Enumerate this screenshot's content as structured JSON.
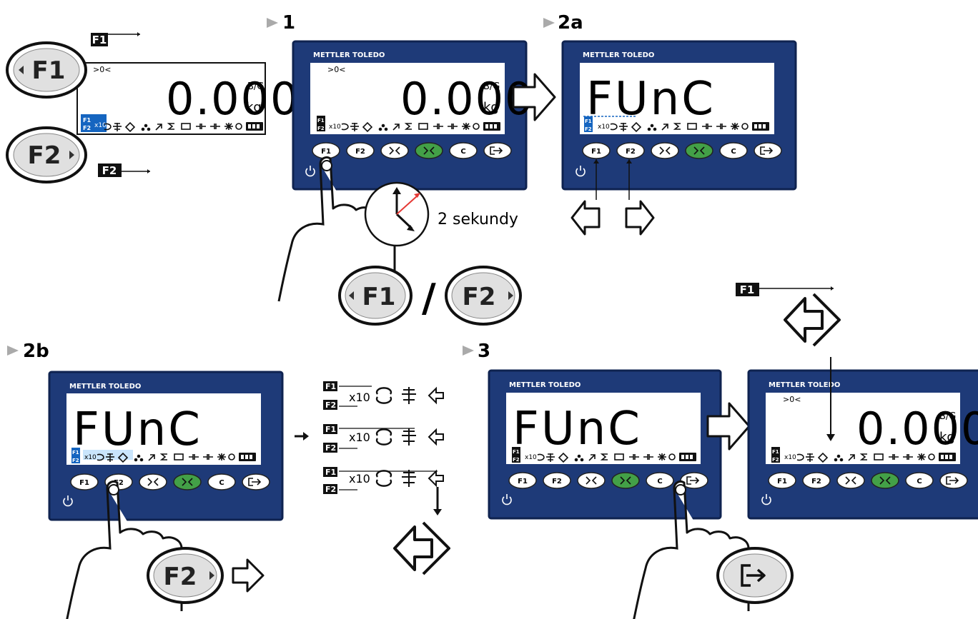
{
  "steps": {
    "s1": "1",
    "s2a": "2a",
    "s2b": "2b",
    "s3": "3"
  },
  "brand": "METTLER TOLEDO",
  "display": {
    "zero_indicator": ">0<",
    "weight": "0.000",
    "gross_net": "B/G",
    "unit": "kg",
    "func": "FUnC",
    "x10": "x10",
    "f1_tag": "F1",
    "f2_tag": "F2"
  },
  "keys": {
    "f1": "F1",
    "f2": "F2",
    "c": "C"
  },
  "legend": {
    "f1": "F1",
    "f2": "F2"
  },
  "hold_time": "2 sekundy",
  "separator": "/",
  "colors": {
    "panel": "#1e3a78",
    "panel_edge": "#0f2350",
    "lcd": "#ffffff",
    "accent_blue": "#1565c0",
    "key_green": "#43a047"
  },
  "icons": [
    "arrow-right-icon",
    "arrow-left-icon",
    "hand-icon",
    "clock-icon",
    "enter-diamond-icon",
    "exit-key-icon",
    "power-icon"
  ]
}
